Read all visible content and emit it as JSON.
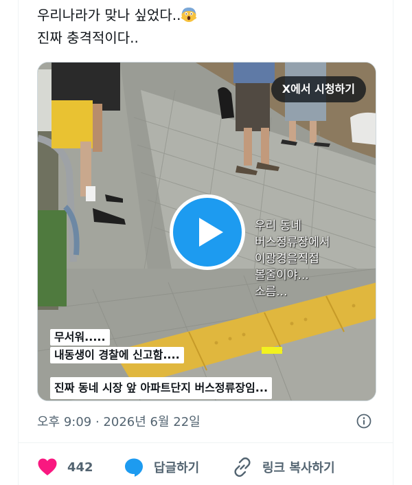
{
  "tweet": {
    "text_line1": "우리나라가 맞나 싶었다..",
    "text_line2": "진짜 충격적이다.."
  },
  "media": {
    "watch_on_x_label": "X에서 시청하기",
    "overlay_lines": [
      "우리 동네",
      "버스정류장에서",
      "이광경을직접",
      "볼줄이야...",
      "소름..."
    ],
    "captions": [
      "무서워.....",
      "내동생이 경찰에 신고함....",
      "진짜 동네 시장 앞 아파트단지 버스정류장임..."
    ]
  },
  "meta": {
    "timestamp": "오후 9:09 · 2026년 6월 22일"
  },
  "actions": {
    "like_count": "442",
    "reply_label": "답글하기",
    "copy_link_label": "링크 복사하기"
  },
  "colors": {
    "like": "#f91880",
    "reply": "#1d9bf0",
    "play_button": "#1d9bf0",
    "secondary_text": "#536471"
  },
  "icons": [
    "screaming-face-emoji",
    "play-icon",
    "info-icon",
    "heart-icon",
    "reply-bubble-icon",
    "link-icon"
  ]
}
